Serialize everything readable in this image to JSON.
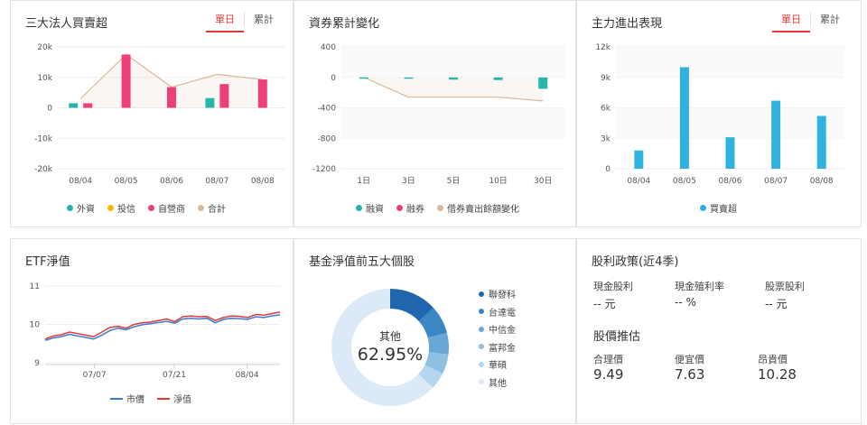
{
  "panels": {
    "institutional": {
      "title": "三大法人買賣超",
      "tabs": [
        "單日",
        "累計"
      ],
      "active_tab": 0,
      "legend": [
        {
          "name": "外資",
          "color": "#26b7a9"
        },
        {
          "name": "投信",
          "color": "#f5b800"
        },
        {
          "name": "自營商",
          "color": "#ef3f7a"
        },
        {
          "name": "合計",
          "color": "#d9b99b"
        }
      ]
    },
    "margin": {
      "title": "資券累計變化",
      "legend": [
        {
          "name": "融資",
          "color": "#26b7a9"
        },
        {
          "name": "融券",
          "color": "#ef3f7a"
        },
        {
          "name": "借券賣出餘額變化",
          "color": "#d9b99b"
        }
      ]
    },
    "main_force": {
      "title": "主力進出表現",
      "tabs": [
        "單日",
        "累計"
      ],
      "active_tab": 0,
      "legend": [
        {
          "name": "買賣超",
          "color": "#2eb2e0"
        }
      ]
    },
    "nav": {
      "title": "ETF淨值",
      "legend": [
        {
          "name": "市價",
          "color": "#3a7cd5"
        },
        {
          "name": "淨值",
          "color": "#e53935"
        }
      ]
    },
    "holdings": {
      "title": "基金淨值前五大個股",
      "center_label": "其他",
      "center_value": "62.95%",
      "legend": [
        {
          "name": "聯發科",
          "color": "#1f66ad"
        },
        {
          "name": "台達電",
          "color": "#3b86c4"
        },
        {
          "name": "中信金",
          "color": "#68a7d6"
        },
        {
          "name": "富邦金",
          "color": "#8fc0e3"
        },
        {
          "name": "華碩",
          "color": "#b6d5ee"
        },
        {
          "name": "其他",
          "color": "#dce9f6"
        }
      ]
    },
    "dividend": {
      "title": "股利政策(近4季)",
      "items": [
        {
          "label": "現金股利",
          "value": "-- 元"
        },
        {
          "label": "現金殖利率",
          "value": "-- %"
        },
        {
          "label": "股票股利",
          "value": "-- 元"
        }
      ],
      "price_title": "股價推估",
      "prices": [
        {
          "label": "合理價",
          "value": "9.49"
        },
        {
          "label": "便宜價",
          "value": "7.63"
        },
        {
          "label": "昂貴價",
          "value": "10.28"
        }
      ]
    }
  },
  "chart_data": [
    {
      "id": "institutional",
      "type": "bar",
      "categories": [
        "08/04",
        "08/05",
        "08/06",
        "08/07",
        "08/08"
      ],
      "ylim": [
        -20000,
        20000
      ],
      "yticks": [
        "20k",
        "10k",
        "0",
        "-10k",
        "-20k"
      ],
      "series": [
        {
          "name": "外資",
          "values": [
            1500,
            0,
            0,
            3200,
            0
          ]
        },
        {
          "name": "投信",
          "values": [
            0,
            0,
            0,
            0,
            0
          ]
        },
        {
          "name": "自營商",
          "values": [
            1500,
            17500,
            6800,
            7800,
            9300
          ]
        },
        {
          "name": "合計",
          "type": "area",
          "values": [
            3000,
            17500,
            6800,
            11000,
            9300
          ]
        }
      ]
    },
    {
      "id": "margin",
      "type": "bar",
      "categories": [
        "1日",
        "3日",
        "5日",
        "10日",
        "30日"
      ],
      "ylim": [
        -1200,
        400
      ],
      "yticks": [
        "400",
        "0",
        "-400",
        "-800",
        "-1200"
      ],
      "series": [
        {
          "name": "融資",
          "values": [
            -10,
            -8,
            -30,
            -35,
            -150
          ]
        },
        {
          "name": "融券",
          "values": [
            0,
            0,
            0,
            0,
            0
          ]
        },
        {
          "name": "借券賣出餘額變化",
          "type": "area",
          "values": [
            0,
            -260,
            -260,
            -260,
            -310
          ]
        }
      ]
    },
    {
      "id": "main_force",
      "type": "bar",
      "categories": [
        "08/04",
        "08/05",
        "08/06",
        "08/07",
        "08/08"
      ],
      "ylim": [
        0,
        12000
      ],
      "yticks": [
        "12k",
        "9k",
        "6k",
        "3k",
        "0"
      ],
      "series": [
        {
          "name": "買賣超",
          "values": [
            1800,
            10000,
            3100,
            6700,
            5200
          ]
        }
      ]
    },
    {
      "id": "nav",
      "type": "line",
      "ylim": [
        9,
        11
      ],
      "yticks": [
        "11",
        "10",
        "9"
      ],
      "xticks": [
        "07/07",
        "07/21",
        "08/04"
      ],
      "series": [
        {
          "name": "市價",
          "values": [
            9.58,
            9.65,
            9.68,
            9.74,
            9.7,
            9.66,
            9.62,
            9.72,
            9.84,
            9.9,
            9.86,
            9.94,
            9.99,
            10.02,
            10.05,
            10.08,
            10.03,
            10.14,
            10.16,
            10.14,
            10.16,
            10.04,
            10.13,
            10.16,
            10.15,
            10.13,
            10.2,
            10.18,
            10.22,
            10.25
          ]
        },
        {
          "name": "淨值",
          "values": [
            9.62,
            9.7,
            9.73,
            9.8,
            9.76,
            9.72,
            9.68,
            9.8,
            9.92,
            9.95,
            9.9,
            10.0,
            10.04,
            10.06,
            10.1,
            10.14,
            10.07,
            10.2,
            10.22,
            10.2,
            10.21,
            10.1,
            10.18,
            10.22,
            10.21,
            10.18,
            10.26,
            10.24,
            10.28,
            10.32
          ]
        }
      ]
    },
    {
      "id": "holdings",
      "type": "pie",
      "categories": [
        "聯發科",
        "台達電",
        "中信金",
        "富邦金",
        "華碩",
        "其他"
      ],
      "values": [
        13.2,
        7.8,
        5.9,
        5.5,
        4.65,
        62.95
      ]
    }
  ]
}
